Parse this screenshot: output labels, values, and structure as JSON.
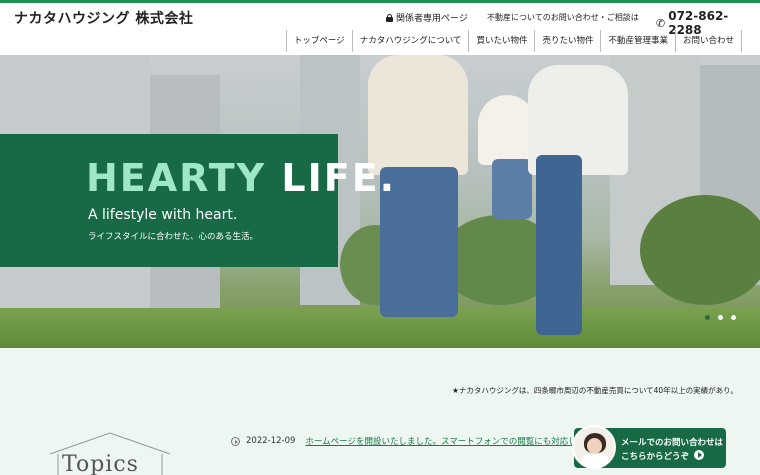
{
  "header": {
    "logo": "ナカタハウジング 株式会社",
    "member_label": "関係者専用ページ",
    "inquiry_text": "不動産についてのお問い合わせ・ご相談は",
    "phone": "072-862-2288"
  },
  "nav": {
    "items": [
      {
        "label": "トップページ"
      },
      {
        "label": "ナカタハウジングについて"
      },
      {
        "label": "買いたい物件"
      },
      {
        "label": "売りたい物件"
      },
      {
        "label": "不動産管理事業"
      },
      {
        "label": "お問い合わせ"
      }
    ]
  },
  "hero": {
    "title_green": "HEARTY ",
    "title_white": "LIFE.",
    "subtitle": "A lifestyle with heart.",
    "jp_tagline": "ライフスタイルに合わせた、心のある生活。",
    "slide_count": 3,
    "active_slide": 1
  },
  "ticker": {
    "text": "★ナカタハウジングは、四条畷市周辺の不動産売買について40年以上の実績があり。"
  },
  "topics": {
    "title": "Topics"
  },
  "news": [
    {
      "date": "2022-12-09",
      "text": "ホームページを開設いたしました。スマートフォンでの閲覧にも対応していま"
    }
  ],
  "mail_cta": {
    "line1": "メールでのお問い合わせは",
    "line2": "こちらからどうぞ"
  },
  "colors": {
    "brand_green": "#176a45",
    "hero_title_green": "#9ee8c6",
    "link_green": "#1a7a46",
    "page_bg": "#eef6f2"
  }
}
